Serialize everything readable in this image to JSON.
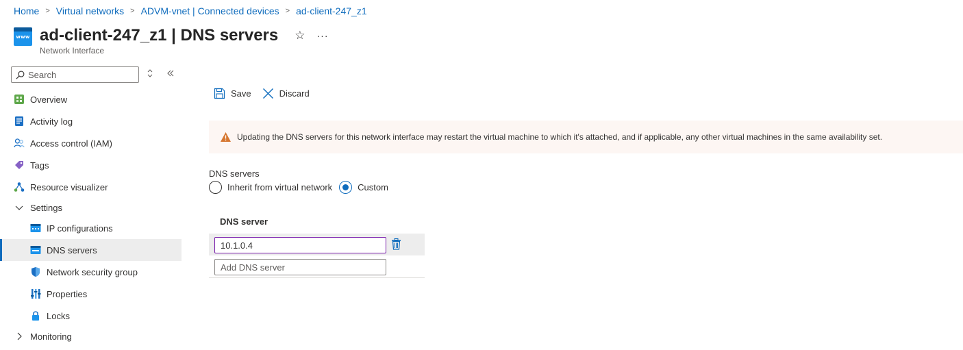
{
  "breadcrumb": [
    {
      "label": "Home"
    },
    {
      "label": "Virtual networks"
    },
    {
      "label": "ADVM-vnet | Connected devices"
    },
    {
      "label": "ad-client-247_z1"
    }
  ],
  "header": {
    "resource_name": "ad-client-247_z1",
    "separator": " | ",
    "page_name": "DNS servers",
    "subtitle": "Network Interface",
    "icon_text": "www",
    "favorite_icon": "☆",
    "more_icon": "···"
  },
  "sidebar": {
    "search_placeholder": "Search",
    "items": [
      {
        "label": "Overview",
        "icon": "overview-icon"
      },
      {
        "label": "Activity log",
        "icon": "activity-log-icon"
      },
      {
        "label": "Access control (IAM)",
        "icon": "iam-icon"
      },
      {
        "label": "Tags",
        "icon": "tag-icon"
      },
      {
        "label": "Resource visualizer",
        "icon": "visualizer-icon"
      },
      {
        "label": "Settings",
        "icon": "chevron-down-icon"
      },
      {
        "label": "IP configurations",
        "icon": "ip-config-icon"
      },
      {
        "label": "DNS servers",
        "icon": "dns-icon",
        "active": true
      },
      {
        "label": "Network security group",
        "icon": "shield-icon"
      },
      {
        "label": "Properties",
        "icon": "properties-icon"
      },
      {
        "label": "Locks",
        "icon": "lock-icon"
      },
      {
        "label": "Monitoring",
        "icon": "chevron-right-icon"
      }
    ]
  },
  "toolbar": {
    "save_label": "Save",
    "discard_label": "Discard"
  },
  "warning": {
    "text": "Updating the DNS servers for this network interface may restart the virtual machine to which it's attached, and if applicable, any other virtual machines in the same availability set."
  },
  "dns": {
    "label": "DNS servers",
    "options": [
      {
        "label": "Inherit from virtual network",
        "checked": false
      },
      {
        "label": "Custom",
        "checked": true
      }
    ],
    "column_header": "DNS server",
    "servers": [
      "10.1.0.4"
    ],
    "add_placeholder": "Add DNS server"
  },
  "colors": {
    "link": "#0f6cbd",
    "accent": "#0f6cbd",
    "warning_bg": "#fdf6f3",
    "warning_icon": "#d67730",
    "focus_border": "#7719aa"
  }
}
